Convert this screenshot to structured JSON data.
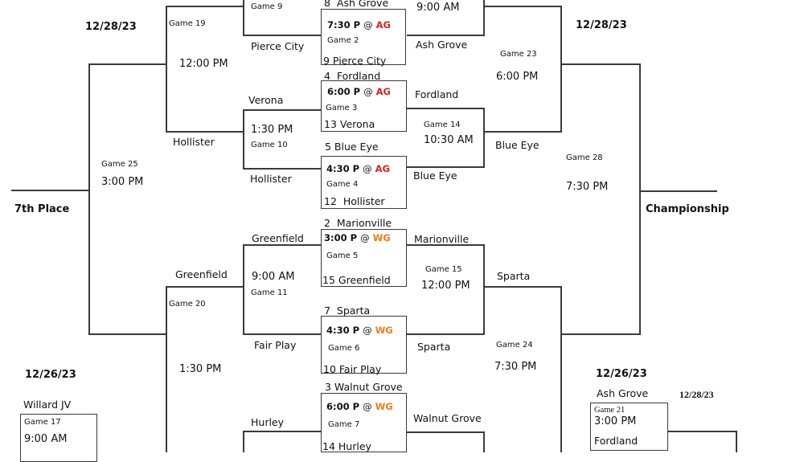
{
  "dates": {
    "left_top": "12/28/23",
    "right_top": "12/28/23",
    "left_bottom": "12/26/23",
    "right_bottom": "12/26/23",
    "right_bottom_2": "12/28/23"
  },
  "labels": {
    "seventh_place": "7th Place",
    "championship": "Championship"
  },
  "first_round": [
    {
      "game": "Game 2",
      "time": "7:30 P",
      "at": "@",
      "venue": "AG",
      "top": "8  Ash Grove",
      "bottom": "9 Pierce City"
    },
    {
      "game": "Game 3",
      "time": "6:00 P",
      "at": "@",
      "venue": "AG",
      "top": "4  Fordland",
      "bottom": "13 Verona"
    },
    {
      "game": "Game 4",
      "time": "4:30 P",
      "at": "@",
      "venue": "AG",
      "top": "5 Blue Eye",
      "bottom": "12  Hollister"
    },
    {
      "game": "Game 5",
      "time": "3:00 P",
      "at": "@",
      "venue": "WG",
      "top": "2  Marionville",
      "bottom": "15 Greenfield"
    },
    {
      "game": "Game 6",
      "time": "4:30 P",
      "at": "@",
      "venue": "WG",
      "top": "7  Sparta",
      "bottom": "10 Fair Play"
    },
    {
      "game": "Game 7",
      "time": "6:00 P",
      "at": "@",
      "venue": "WG",
      "top": "3 Walnut Grove",
      "bottom": "14 Hurley"
    }
  ],
  "consolation": {
    "game9": {
      "game": "Game 9",
      "bottom": "Pierce City"
    },
    "game10": {
      "game": "Game 10",
      "time": "1:30 PM",
      "top": "Verona",
      "bottom": "Hollister"
    },
    "game11": {
      "game": "Game 11",
      "time": "9:00 AM",
      "top": "Greenfield",
      "bottom": "Fair Play"
    },
    "game12": {
      "top": "Hurley"
    },
    "game19": {
      "game": "Game 19",
      "time": "12:00 PM",
      "bottom": "Hollister"
    },
    "game20": {
      "game": "Game 20",
      "time": "1:30 PM",
      "top": "Greenfield"
    },
    "game25": {
      "game": "Game 25",
      "time": "3:00 PM"
    }
  },
  "winners": {
    "game13": {
      "time": "9:00 AM",
      "bottom": "Ash Grove"
    },
    "game14": {
      "game": "Game 14",
      "time": "10:30 AM",
      "top": "Fordland",
      "bottom": "Blue Eye"
    },
    "game15": {
      "game": "Game 15",
      "time": "12:00 PM",
      "top": "Marionville",
      "bottom": "Sparta"
    },
    "game16": {
      "top": "Walnut Grove"
    },
    "game23": {
      "game": "Game 23",
      "time": "6:00 PM",
      "bottom": "Blue Eye"
    },
    "game24": {
      "game": "Game 24",
      "time": "7:30 PM",
      "top": "Sparta"
    },
    "game28": {
      "game": "Game 28",
      "time": "7:30 PM"
    }
  },
  "game17": {
    "game": "Game 17",
    "time": "9:00 AM",
    "top": "Willard JV"
  },
  "game21": {
    "game": "Game 21",
    "time": "3:00 PM",
    "top": "Ash Grove",
    "bottom": "Fordland"
  },
  "colors": {
    "ag": "#e0201c",
    "wg": "#ef7d12",
    "line": "#3a3a3a"
  }
}
